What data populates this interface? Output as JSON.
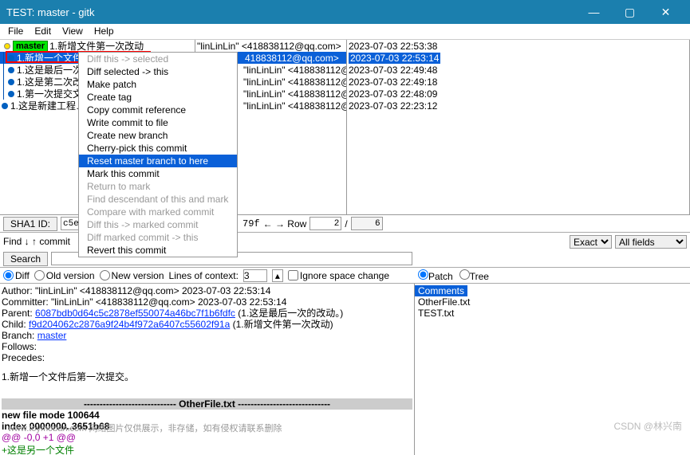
{
  "window": {
    "title": "TEST: master - gitk"
  },
  "menu": {
    "file": "File",
    "edit": "Edit",
    "view": "View",
    "help": "Help"
  },
  "commits": {
    "col1": [
      "1.新增文件第一次改动",
      "1.新增一个文件…",
      "1.这是最后一次…",
      "1.这是第二次改…",
      "1.第一次提交文…",
      "1.这是新建工程…"
    ],
    "branch_tag": "master",
    "col2_selected_truncated": "418838112@qq.com>",
    "author_display": "\"linLinLin\" <418838112@qq.com>",
    "dates": [
      "2023-07-03 22:53:38",
      "2023-07-03 22:53:14",
      "2023-07-03 22:49:48",
      "2023-07-03 22:49:18",
      "2023-07-03 22:48:09",
      "2023-07-03 22:23:12"
    ]
  },
  "ctx": {
    "items": [
      {
        "label": "Diff this -> selected",
        "dis": true
      },
      {
        "label": "Diff selected -> this",
        "dis": false
      },
      {
        "label": "Make patch",
        "dis": false
      },
      {
        "label": "Create tag",
        "dis": false
      },
      {
        "label": "Copy commit reference",
        "dis": false
      },
      {
        "label": "Write commit to file",
        "dis": false
      },
      {
        "label": "Create new branch",
        "dis": false
      },
      {
        "label": "Cherry-pick this commit",
        "dis": false
      },
      {
        "label": "Reset master branch to here",
        "dis": false,
        "hi": true
      },
      {
        "label": "Mark this commit",
        "dis": false
      },
      {
        "label": "Return to mark",
        "dis": true
      },
      {
        "label": "Find descendant of this and mark",
        "dis": true
      },
      {
        "label": "Compare with marked commit",
        "dis": true
      },
      {
        "label": "Diff this -> marked commit",
        "dis": true
      },
      {
        "label": "Diff marked commit -> this",
        "dis": true
      },
      {
        "label": "Revert this commit",
        "dis": false
      }
    ]
  },
  "mid": {
    "sha_label": "SHA1 ID:",
    "sha_val": "c5e2a",
    "sha_tail": "79f",
    "row_label": "← → Row",
    "row_cur": "2",
    "row_sep": "/",
    "row_total": "6"
  },
  "find": {
    "label": "Find ↓ ↑  commit",
    "search_btn": "Search",
    "exact": "Exact",
    "allfields": "All fields"
  },
  "opts": {
    "diff": "Diff",
    "oldver": "Old version",
    "newver": "New version",
    "loc_label": "Lines of context:",
    "loc_val": "3",
    "ignorespace": "Ignore space change",
    "patch": "Patch",
    "tree": "Tree"
  },
  "meta": {
    "author": "Author: \"linLinLin\" <418838112@qq.com>  2023-07-03 22:53:14",
    "committer": "Committer: \"linLinLin\" <418838112@qq.com>  2023-07-03 22:53:14",
    "parent_lbl": "Parent: ",
    "parent_hash": "6087bdb0d64c5c2878ef550074a46bc7f1b6fdfc",
    "parent_msg": " (1.这是最后一次的改动。)",
    "child_lbl": "Child:  ",
    "child_hash": "f9d204062c2876a9f24b4f972a6407c55602f91a",
    "child_msg": " (1.新增文件第一次改动)",
    "branch_lbl": "Branch: ",
    "branch_link": "master",
    "follows": "Follows:",
    "precedes": "Precedes:",
    "subject": "1.新增一个文件后第一次提交。"
  },
  "diff": {
    "header": "----------------------------- OtherFile.txt -----------------------------",
    "l1": "new file mode 100644",
    "l2": "index 0000000..3651b68",
    "l3": "@@ -0,0 +1 @@",
    "l4": "+这是另一个文件"
  },
  "files": {
    "comments": "Comments",
    "f1": "OtherFile.txt",
    "f2": "TEST.txt"
  },
  "watermark": "www.toymoban.com 网络图片仅供展示，非存储，如有侵权请联系删除",
  "csdn": "CSDN @林兴南"
}
